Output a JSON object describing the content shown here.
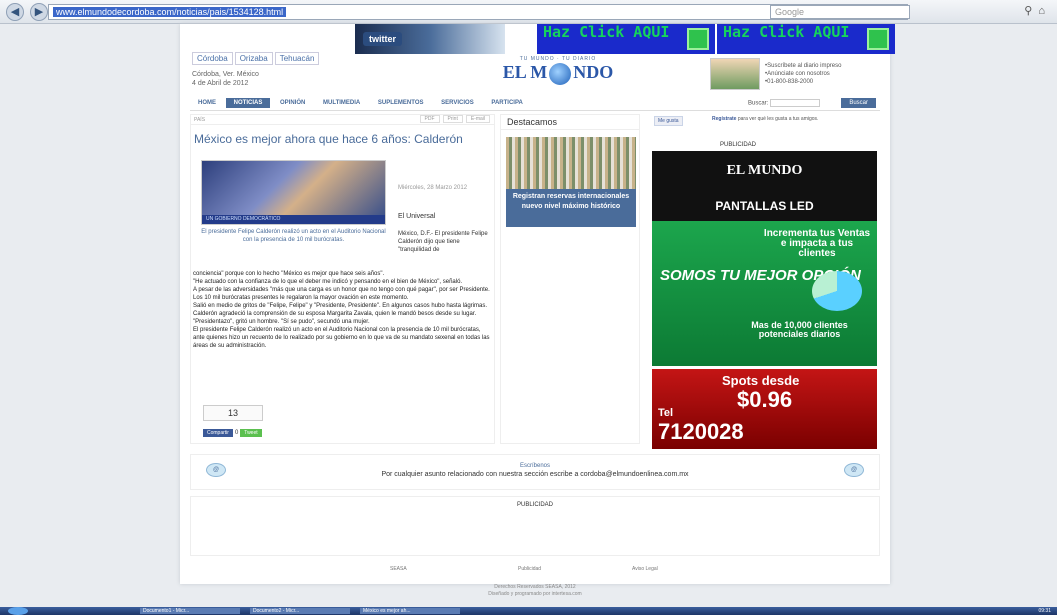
{
  "browser": {
    "url": "www.elmundodecordoba.com/noticias/pais/1534128.html",
    "search_placeholder": "Google",
    "back": "◀",
    "forward": "▶"
  },
  "banners": {
    "left_logo": "twitter",
    "ad_text": "Haz Click AQUI"
  },
  "header": {
    "cities": [
      "Córdoba",
      "Orizaba",
      "Tehuacán"
    ],
    "location": "Córdoba, Ver. México",
    "date": "4 de Abril de 2012",
    "logo_tagline": "TU MUNDO · TU DIARIO",
    "logo_name_left": "EL M",
    "logo_name_right": "NDO",
    "promo_items": [
      "•Suscríbete al diario impreso",
      "•Anúnciate con nosotros",
      "•01-800-838-2000"
    ]
  },
  "nav": {
    "items": [
      "HOME",
      "NOTICIAS",
      "OPINIÓN",
      "MULTIMEDIA",
      "SUPLEMENTOS",
      "SERVICIOS",
      "PARTICIPA"
    ],
    "active": "NOTICIAS",
    "search_label": "Buscar:",
    "search_button": "Buscar"
  },
  "article": {
    "section": "PAÍS",
    "tools": [
      "PDF",
      "Print",
      "E-mail"
    ],
    "headline": "México es mejor ahora que hace 6 años: Calderón",
    "photo_banner": "UN GOBIERNO DEMOCRÁTICO",
    "caption": "El presidente Felipe Calderón realizó un acto en el Auditorio Nacional con la presencia de 10 mil burócratas.",
    "date": "Miércoles, 28 Marzo 2012",
    "source": "El Universal",
    "lead": "México, D.F.- El presidente Felipe Calderón dijo que tiene \"tranquilidad de",
    "body": [
      "conciencia\" porque con lo hecho \"México es mejor que hace seis años\".",
      "\"He actuado con la confianza de lo que el deber me indicó y pensando en el bien de México\", señaló.",
      "A pesar de las adversidades \"más que una carga es un honor que no tengo con qué pagar\", por ser Presidente. Los 10 mil burócratas presentes le regalaron la mayor ovación en este momento.",
      "Salió en medio de gritos de \"Felipe, Felipe\" y \"Presidente, Presidente\". En algunos casos hubo hasta lágrimas.",
      "Calderón agradeció la comprensión de su esposa Margarita Zavala, quien le mandó besos desde su lugar. \"Presidentazo\", gritó un hombre. \"Sí se pudo\", secundó una mujer.",
      "El presidente Felipe Calderón realizó un acto en el Auditorio Nacional con la presencia de 10 mil burócratas, ante quienes hizo un recuento de lo realizado por su gobierno en lo que va de su mandato sexenal en todas las áreas de su administración."
    ],
    "share_count": "13",
    "fb_share": "Compartir",
    "zero": "0",
    "tweet": "Tweet"
  },
  "featured": {
    "title": "Destacamos",
    "caption": "Registran reservas internacionales nuevo nivel máximo histórico"
  },
  "sidebar": {
    "like": "Me gusta",
    "fb_register": "Regístrate",
    "fb_text": "para ver qué les gusta a tus amigos.",
    "publicidad": "PUBLICIDAD",
    "ad1_title": "EL MUNDO",
    "ad1_sub": "PANTALLAS LED",
    "ad1_line1": "Incrementa tus Ventas e impacta a tus clientes",
    "ad1_line2": "SOMOS TU MEJOR OPCIÓN",
    "ad1_line3": "Mas de 10,000 clientes potenciales diarios",
    "ad2_spots": "Spots desde",
    "ad2_price": "$0.96",
    "ad2_tel": "Tel",
    "ad2_num": "7120028"
  },
  "contact": {
    "title": "Escríbenos",
    "message": "Por cualquier asunto relacionado con nuestra sección escribe a cordoba@elmundoenlinea.com.mx",
    "icon_text": "@"
  },
  "publicidad2": "PUBLICIDAD",
  "footer": {
    "links": [
      "SEASA",
      "Publicidad",
      "Aviso Legal"
    ],
    "copyright": "Derechos Reservados SEASA, 2012",
    "credits": "Diseñado y programado por intertesa.com"
  },
  "taskbar": {
    "tasks": [
      "Documento1 - Micr...",
      "Documento2 - Micr...",
      "México es mejor ah..."
    ],
    "clock": "09:31"
  }
}
